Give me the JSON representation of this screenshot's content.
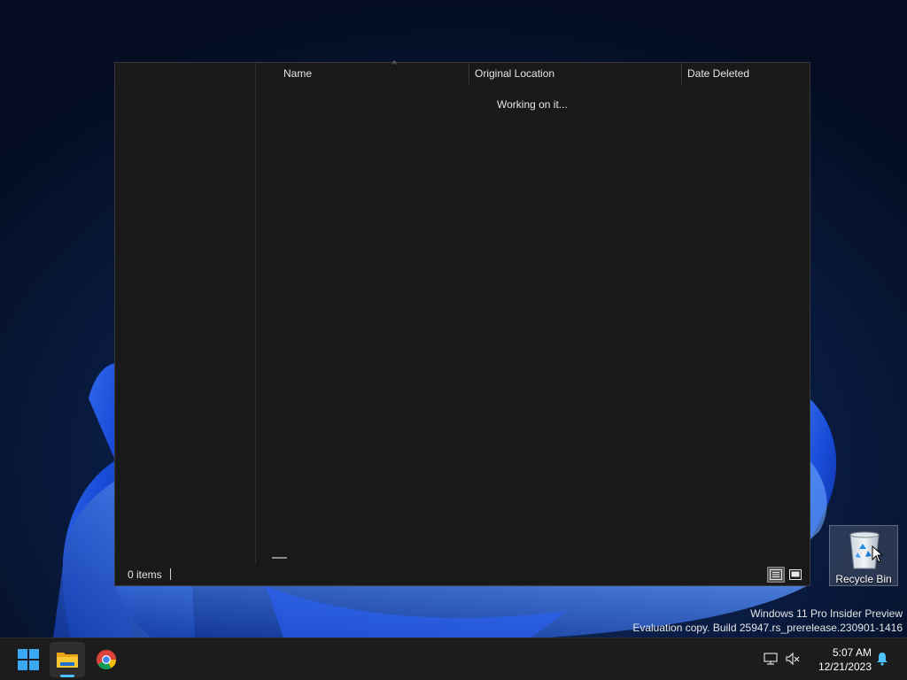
{
  "explorer": {
    "columns": {
      "name": "Name",
      "original_location": "Original Location",
      "date_deleted": "Date Deleted"
    },
    "sort_indicator": "^",
    "loading_text": "Working on it...",
    "status": {
      "item_count": "0 items"
    },
    "view_modes": {
      "details_icon": "details-view-icon",
      "tiles_icon": "large-icons-view-icon"
    }
  },
  "desktop": {
    "icons": [
      {
        "label": "Recycle Bin",
        "icon": "recycle-bin-icon",
        "selected": true
      }
    ]
  },
  "watermark": {
    "line1": "Windows 11 Pro Insider Preview",
    "line2": "Evaluation copy. Build 25947.rs_prerelease.230901-1416"
  },
  "taskbar": {
    "apps": [
      {
        "name": "Start",
        "icon": "windows-start-icon"
      },
      {
        "name": "File Explorer",
        "icon": "file-explorer-icon",
        "active": true
      },
      {
        "name": "Google Chrome",
        "icon": "chrome-icon"
      }
    ],
    "tray": {
      "icons": [
        "network-icon",
        "volume-muted-icon",
        "notification-bell-icon"
      ],
      "time": "5:07 AM",
      "date": "12/21/2023"
    },
    "accent_color": "#4cc2ff"
  }
}
